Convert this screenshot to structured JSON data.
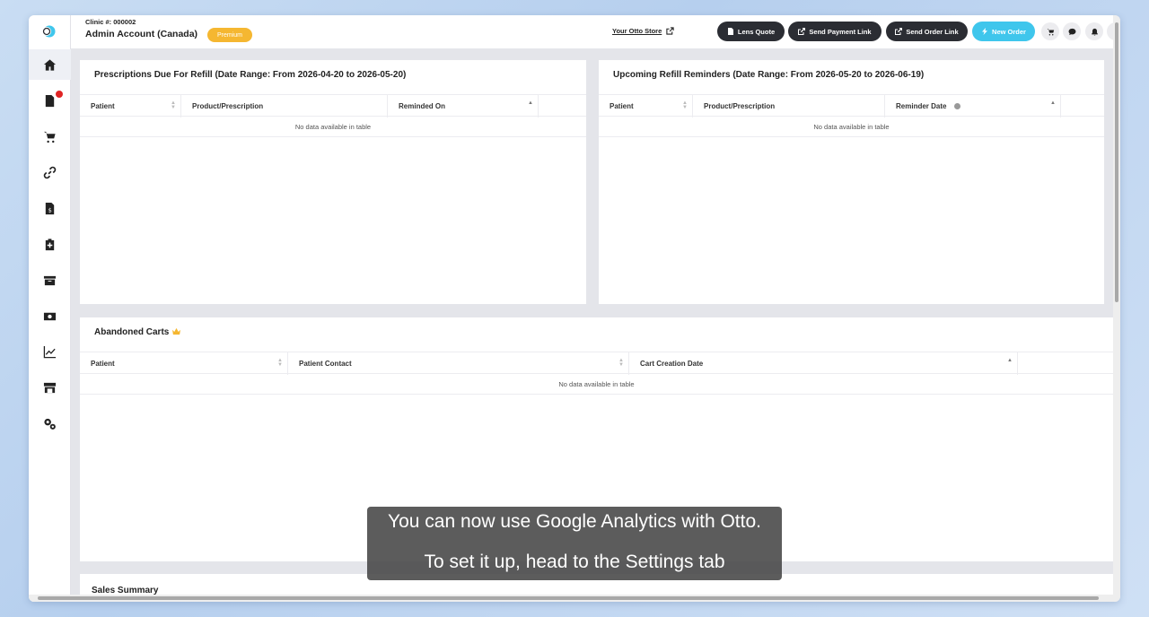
{
  "header": {
    "clinic_number": "Clinic #: 000002",
    "account_name": "Admin Account (Canada)",
    "plan_badge": "Premium",
    "store_link": "Your Otto Store",
    "buttons": {
      "lens_quote": "Lens Quote",
      "send_payment_link": "Send Payment Link",
      "send_order_link": "Send Order Link",
      "new_order": "New Order"
    }
  },
  "sidebar": {
    "items": [
      "home-icon",
      "document-icon",
      "cart-icon",
      "link-icon",
      "invoice-icon",
      "clipboard-plus-icon",
      "box-icon",
      "money-icon",
      "chart-icon",
      "store-icon",
      "settings-icon"
    ]
  },
  "refill_panel": {
    "title": "Prescriptions Due For Refill (Date Range: From 2026-04-20 to 2026-05-20)",
    "columns": [
      "Patient",
      "Product/Prescription",
      "Reminded On"
    ],
    "empty": "No data available in table"
  },
  "reminders_panel": {
    "title": "Upcoming Refill Reminders (Date Range: From 2026-05-20 to 2026-06-19)",
    "columns": [
      "Patient",
      "Product/Prescription",
      "Reminder Date"
    ],
    "empty": "No data available in table"
  },
  "carts_panel": {
    "title": "Abandoned Carts",
    "columns": [
      "Patient",
      "Patient Contact",
      "Cart Creation Date"
    ],
    "empty": "No data available in table"
  },
  "sales_panel": {
    "title": "Sales Summary"
  },
  "caption": {
    "line1": "You can now use Google Analytics with Otto.",
    "line2": "To set it up, head to the Settings tab"
  },
  "colors": {
    "accent_cyan": "#3fc6ec",
    "dark_button": "#2b2d33",
    "premium": "#f5b731",
    "badge": "#e02424"
  }
}
